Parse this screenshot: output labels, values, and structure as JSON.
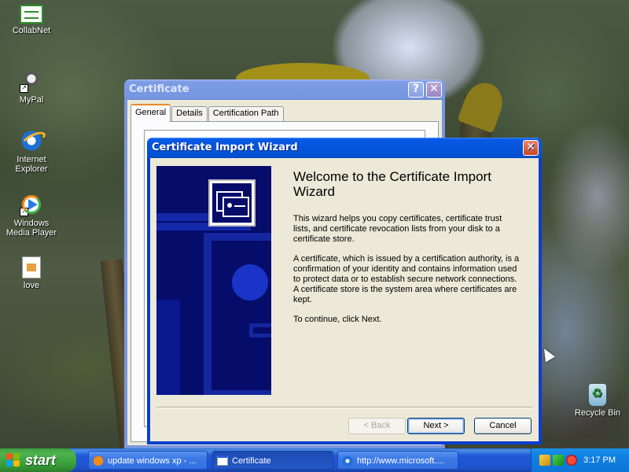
{
  "desktop": {
    "icons": [
      {
        "label": "CollabNet",
        "icon": "collabnet-icon"
      },
      {
        "label": "MyPal",
        "icon": "mypal-icon"
      },
      {
        "label": "Internet Explorer",
        "icon": "internet-explorer-icon"
      },
      {
        "label": "Windows Media Player",
        "icon": "windows-media-player-icon"
      },
      {
        "label": "love",
        "icon": "image-file-icon"
      },
      {
        "label": "Recycle Bin",
        "icon": "recycle-bin-icon"
      }
    ]
  },
  "certificate_window": {
    "title": "Certificate",
    "help_label": "?",
    "close_label": "✕",
    "tabs": [
      {
        "label": "General",
        "selected": true
      },
      {
        "label": "Details",
        "selected": false
      },
      {
        "label": "Certification Path",
        "selected": false
      }
    ]
  },
  "wizard": {
    "title": "Certificate Import Wizard",
    "close_label": "✕",
    "heading": "Welcome to the Certificate Import Wizard",
    "paragraphs": [
      "This wizard helps you copy certificates, certificate trust lists, and certificate revocation lists from your disk to a certificate store.",
      "A certificate, which is issued by a certification authority, is a confirmation of your identity and contains information used to protect data or to establish secure network connections. A certificate store is the system area where certificates are kept.",
      "To continue, click Next."
    ],
    "buttons": {
      "back": "< Back",
      "next": "Next >",
      "cancel": "Cancel"
    }
  },
  "taskbar": {
    "start_label": "start",
    "tasks": [
      {
        "label": "update windows xp - ...",
        "icon": "firefox-icon",
        "pressed": false
      },
      {
        "label": "Certificate",
        "icon": "window-icon",
        "pressed": true
      },
      {
        "label": "http://www.microsoft....",
        "icon": "internet-explorer-icon",
        "pressed": false
      }
    ],
    "clock": "3:17 PM"
  },
  "colors": {
    "xp_blue": "#0553d8",
    "start_green": "#379d37",
    "wizard_art": "#050c6a",
    "dialog_face": "#ece9d8"
  }
}
